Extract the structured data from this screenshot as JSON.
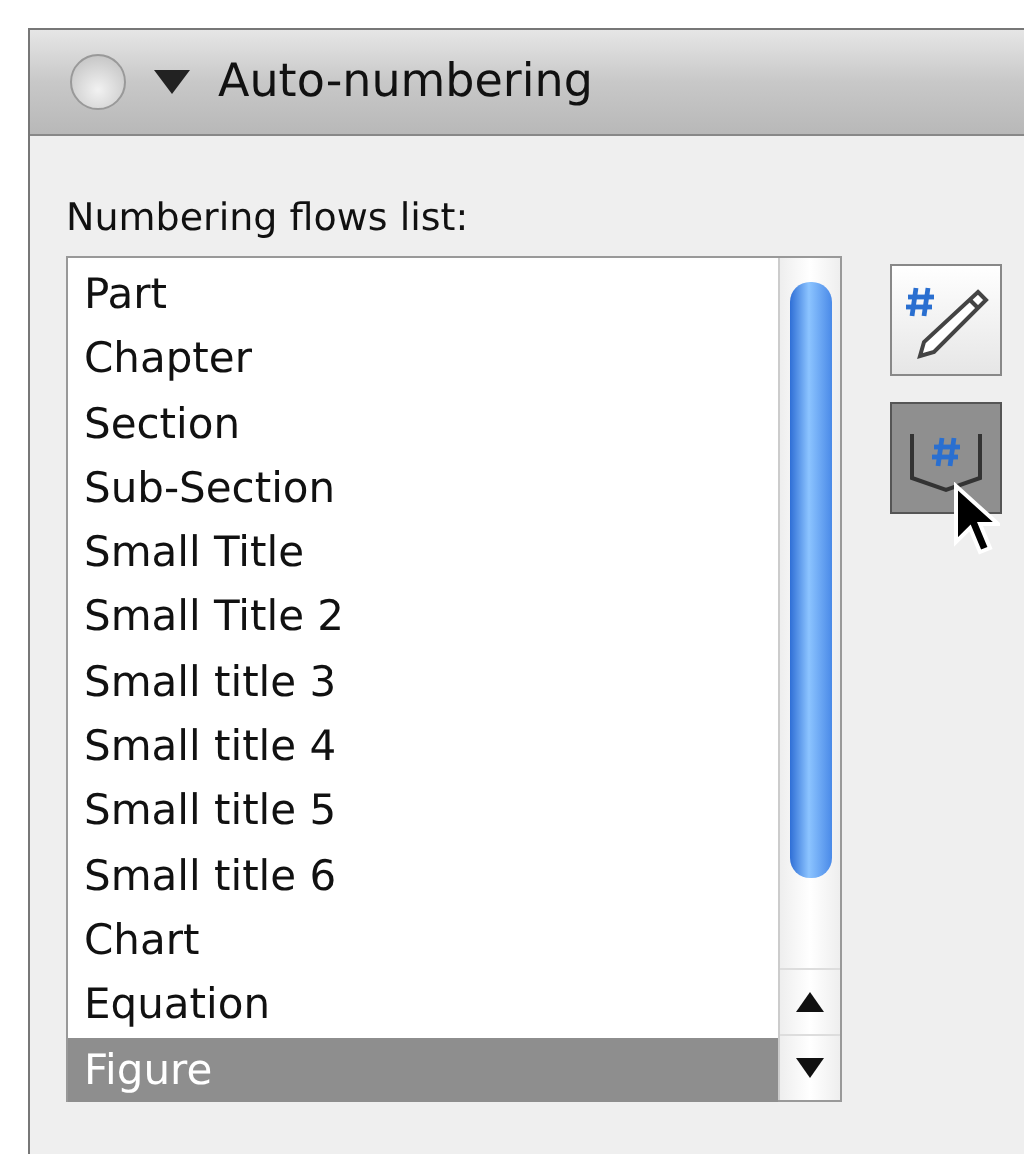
{
  "window": {
    "title": "Auto-numbering",
    "expanded": true
  },
  "list": {
    "label": "Numbering flows list:",
    "items": [
      {
        "label": "Part",
        "selected": false
      },
      {
        "label": "Chapter",
        "selected": false
      },
      {
        "label": "Section",
        "selected": false
      },
      {
        "label": "Sub-Section",
        "selected": false
      },
      {
        "label": "Small Title",
        "selected": false
      },
      {
        "label": "Small Title 2",
        "selected": false
      },
      {
        "label": "Small title 3",
        "selected": false
      },
      {
        "label": "Small title 4",
        "selected": false
      },
      {
        "label": "Small title 5",
        "selected": false
      },
      {
        "label": "Small title 6",
        "selected": false
      },
      {
        "label": "Chart",
        "selected": false
      },
      {
        "label": "Equation",
        "selected": false
      },
      {
        "label": "Figure",
        "selected": true
      }
    ]
  },
  "buttons": [
    {
      "kind": "edit",
      "pressed": false
    },
    {
      "kind": "insert",
      "pressed": true
    }
  ]
}
